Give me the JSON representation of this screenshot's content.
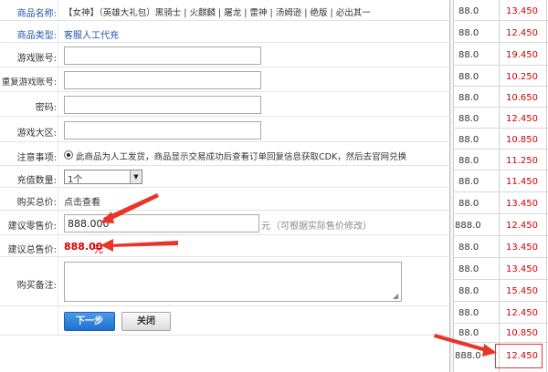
{
  "background_table": {
    "rows": [
      {
        "a": "88.0",
        "b": "13.450"
      },
      {
        "a": "88.0",
        "b": "12.450"
      },
      {
        "a": "88.0",
        "b": "19.450"
      },
      {
        "a": "88.0",
        "b": "10.250"
      },
      {
        "a": "88.0",
        "b": "10.650"
      },
      {
        "a": "88.0",
        "b": "12.450"
      },
      {
        "a": "88.0",
        "b": "10.850"
      },
      {
        "a": "88.0",
        "b": "11.250"
      },
      {
        "a": "88.0",
        "b": "11.450"
      },
      {
        "a": "88.0",
        "b": "13.450"
      },
      {
        "a": "888.0",
        "b": "12.450"
      },
      {
        "a": "88.0",
        "b": "13.450"
      },
      {
        "a": "88.0",
        "b": "13.450"
      },
      {
        "a": "88.0",
        "b": "15.450"
      },
      {
        "a": "88.0",
        "b": "12.450"
      },
      {
        "a": "88.0",
        "b": "10.850"
      },
      {
        "a": "888.0",
        "b": "12.450"
      }
    ]
  },
  "form": {
    "product_name_label": "商品名称:",
    "product_name_value": "【女神】（英雄大礼包）黑骑士 | 火麒麟 | 屠龙 | 雷神 | 汤姆逊 | 绝版 | 必出其一",
    "product_type_label": "商品类型:",
    "product_type_value": "客服人工代充",
    "game_account_label": "游戏账号:",
    "game_account_value": "",
    "repeat_account_label": "重复游戏账号:",
    "repeat_account_value": "",
    "password_label": "密码:",
    "password_value": "",
    "region_label": "游戏大区:",
    "region_value": "",
    "notice_label": "注意事项:",
    "notice_text": "此商品为人工发货，商品显示交易成功后查看订单回复信息获取CDK，然后去官网兑换",
    "quantity_label": "充值数量:",
    "quantity_value": "1个",
    "total_label": "购买总价:",
    "total_value": "点击查看",
    "retail_label": "建议零售价:",
    "retail_value": "888.000",
    "retail_unit": "元",
    "retail_hint": "（可根据实际售价修改）",
    "suggest_total_label": "建议总售价:",
    "suggest_total_value": "888.00",
    "suggest_total_unit": "元",
    "remark_label": "购买备注:",
    "remark_value": "",
    "next_button": "下一步",
    "close_button": "关闭"
  },
  "colors": {
    "accent_blue": "#1f6fd0",
    "price_red": "#d40000",
    "annotation_arrow": "#e8352a"
  }
}
